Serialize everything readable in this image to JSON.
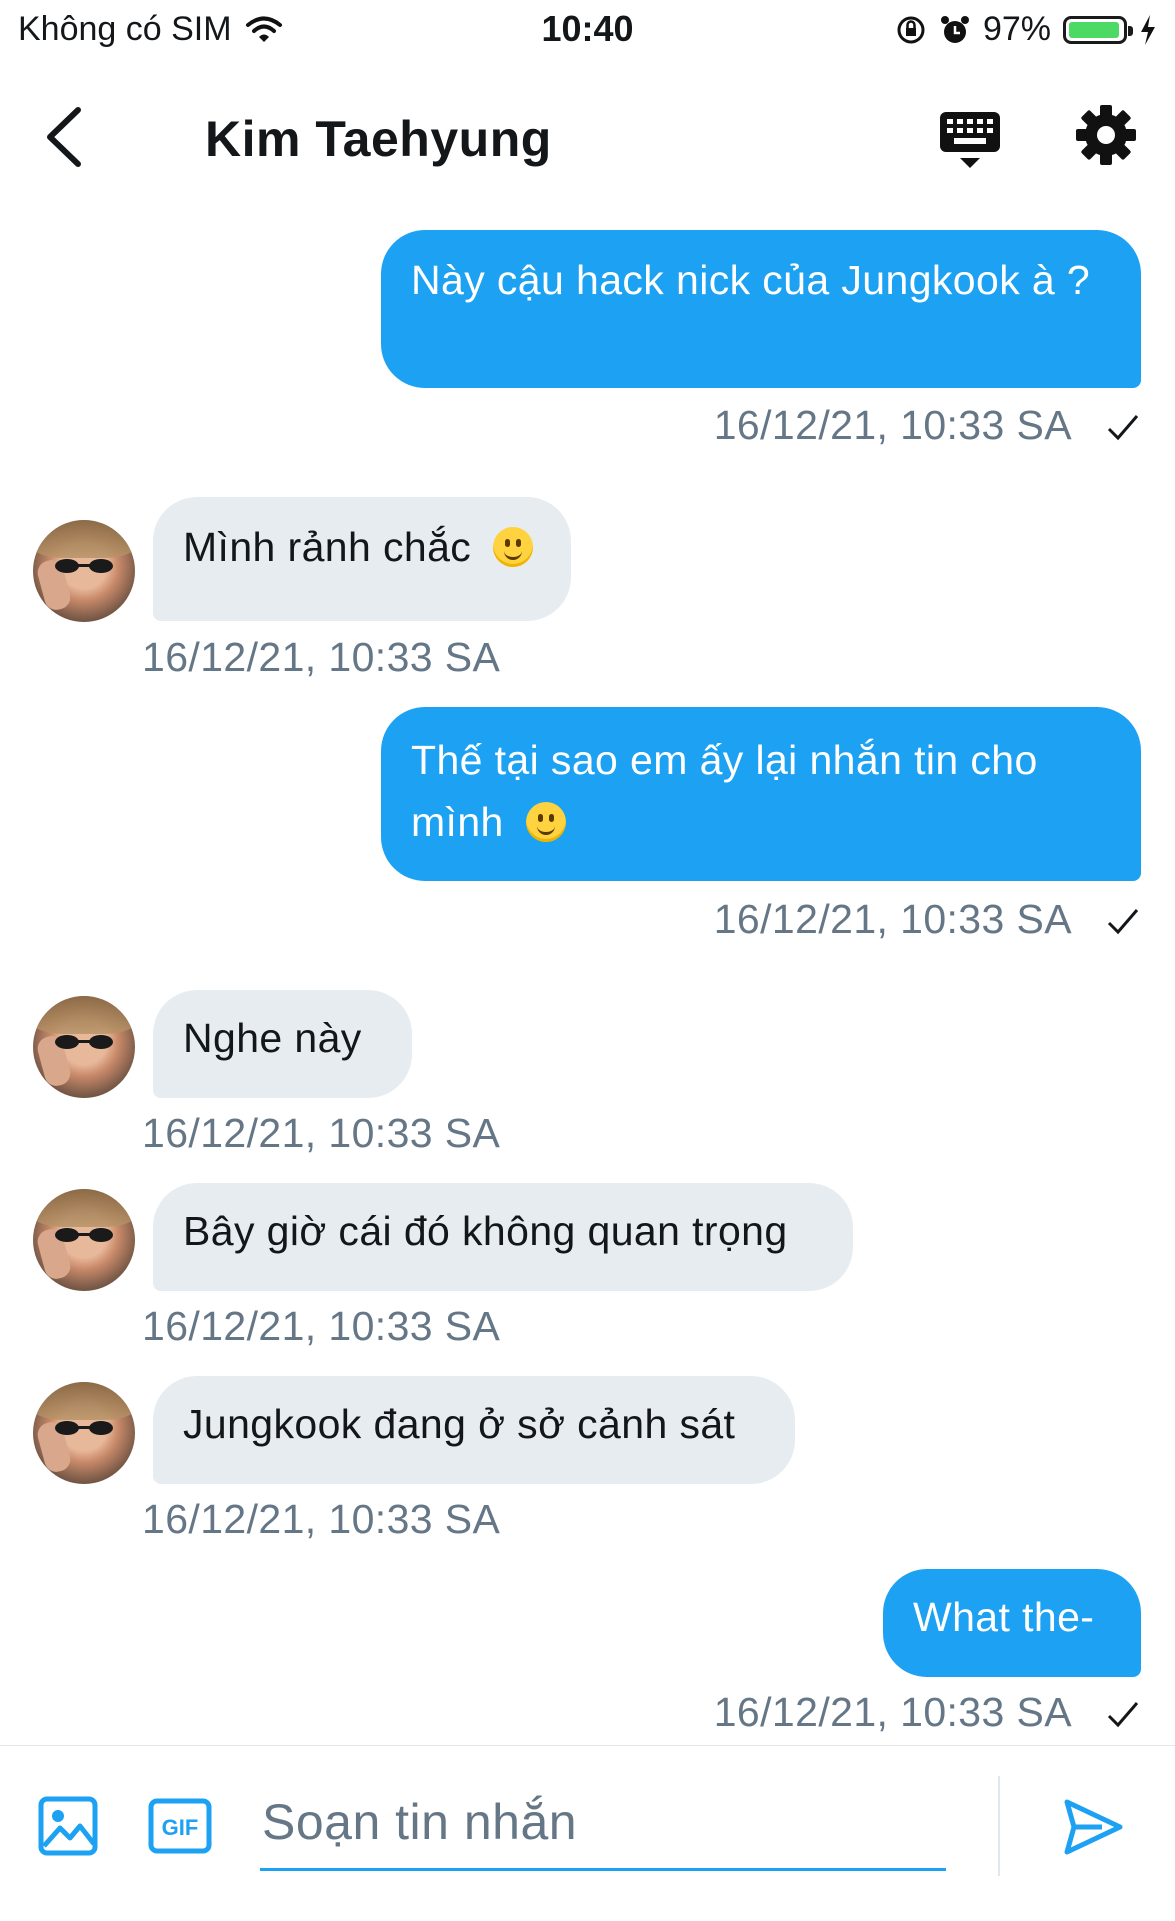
{
  "status_bar": {
    "carrier": "Không có SIM",
    "time": "10:40",
    "battery_percent": "97%",
    "battery_level": 0.97
  },
  "header": {
    "title": "Kim Taehyung"
  },
  "messages": [
    {
      "direction": "outgoing",
      "text": "Này cậu hack nick của Jungkook à ?",
      "timestamp": "16/12/21, 10:33 SA"
    },
    {
      "direction": "incoming",
      "text": "Mình rảnh chắc",
      "emoji": "slightly-smiling-face",
      "timestamp": "16/12/21, 10:33 SA"
    },
    {
      "direction": "outgoing",
      "text": "Thế tại sao em ấy lại nhắn tin cho mình",
      "emoji": "slightly-smiling-face",
      "timestamp": "16/12/21, 10:33 SA"
    },
    {
      "direction": "incoming",
      "text": "Nghe này",
      "timestamp": "16/12/21, 10:33 SA"
    },
    {
      "direction": "incoming",
      "text": "Bây giờ cái đó không quan trọng",
      "timestamp": "16/12/21, 10:33 SA"
    },
    {
      "direction": "incoming",
      "text": "Jungkook đang ở sở cảnh sát",
      "timestamp": "16/12/21, 10:33 SA"
    },
    {
      "direction": "outgoing",
      "text": "What the-",
      "timestamp": "16/12/21, 10:33 SA"
    }
  ],
  "composer": {
    "placeholder": "Soạn tin nhắn"
  },
  "colors": {
    "accent": "#1da1f2",
    "incoming_bubble": "#e6ecf0",
    "timestamp": "#657786",
    "battery": "#4cd964"
  },
  "icons": [
    "back-chevron-icon",
    "keyboard-icon",
    "gear-icon",
    "image-icon",
    "gif-icon",
    "send-icon",
    "wifi-icon",
    "orientation-lock-icon",
    "alarm-icon",
    "battery-icon",
    "charging-bolt-icon",
    "read-checkmark-icon"
  ]
}
